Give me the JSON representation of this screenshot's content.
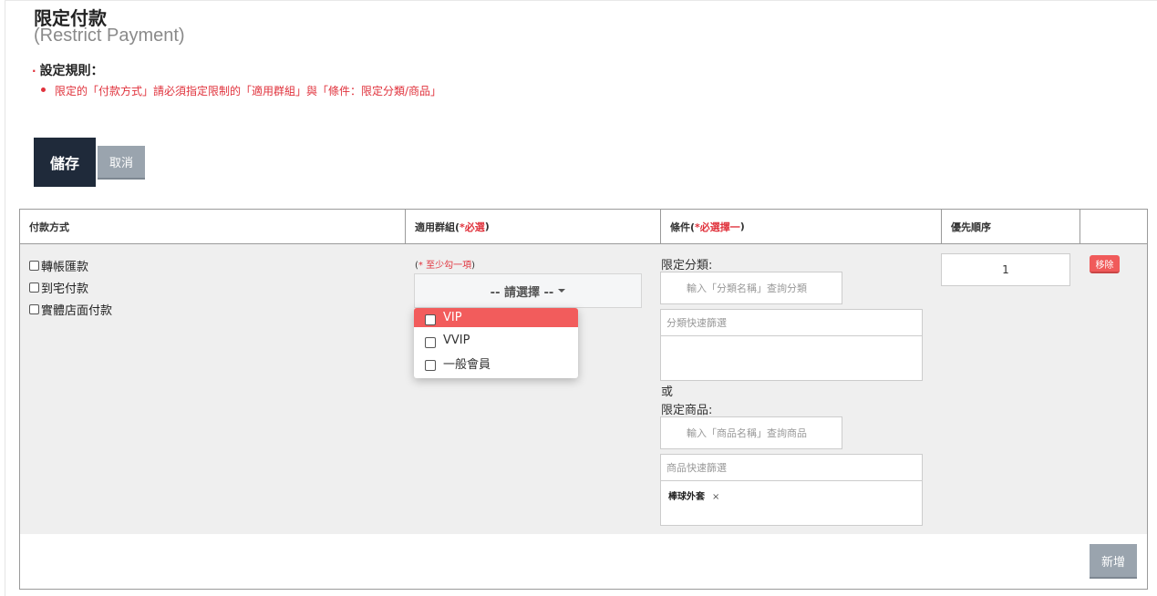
{
  "page": {
    "title": "限定付款",
    "subtitle": "(Restrict Payment)"
  },
  "rules": {
    "heading_dot": "·",
    "heading": "設定規則：",
    "items": [
      "限定的「付款方式」請必須指定限制的「適用群組」與「條件：限定分類/商品」"
    ]
  },
  "toolbar": {
    "save_label": "儲存",
    "cancel_label": "取消"
  },
  "table": {
    "headers": {
      "payment": "付款方式",
      "group": "適用群組(",
      "group_req": "*必選",
      "group_close": ")",
      "condition": "條件(",
      "condition_req": "*必選擇一",
      "condition_close": ")",
      "priority": "優先順序"
    },
    "payment_options": [
      "轉帳匯款",
      "到宅付款",
      "實體店面付款"
    ],
    "group": {
      "hint_open": "(",
      "hint": "* 至少勾一項",
      "hint_close": ")",
      "select_label": "-- 請選擇 --",
      "options": [
        "VIP",
        "VVIP",
        "一般會員"
      ],
      "highlighted": "VIP"
    },
    "condition": {
      "category_label": "限定分類:",
      "category_placeholder": "輸入「分類名稱」查詢分類",
      "category_filter": "分類快速篩選",
      "or_label": "或",
      "product_label": "限定商品:",
      "product_placeholder": "輸入「商品名稱」查詢商品",
      "product_filter": "商品快速篩選",
      "product_tags": [
        "棒球外套"
      ],
      "tag_remove": "×"
    },
    "priority_value": "1",
    "remove_label": "移除",
    "add_label": "新增"
  },
  "colors": {
    "accent_red": "#e0323c",
    "save_bg": "#1f2a3a",
    "gray_button": "#9aa4ae",
    "remove_bg": "#f05a5a",
    "row_bg": "#efefef"
  }
}
